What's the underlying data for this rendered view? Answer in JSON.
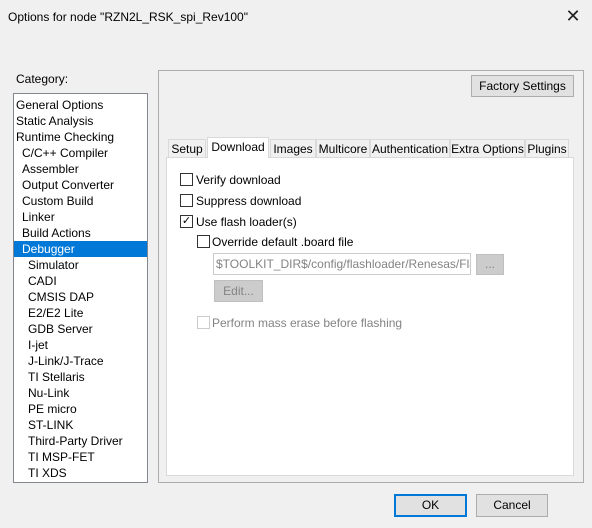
{
  "window": {
    "title": "Options for node \"RZN2L_RSK_spi_Rev100\"",
    "close": "✕"
  },
  "category": {
    "label": "Category:",
    "items": [
      {
        "label": "General Options",
        "level": 0
      },
      {
        "label": "Static Analysis",
        "level": 0
      },
      {
        "label": "Runtime Checking",
        "level": 0
      },
      {
        "label": "C/C++ Compiler",
        "level": 1
      },
      {
        "label": "Assembler",
        "level": 1
      },
      {
        "label": "Output Converter",
        "level": 1
      },
      {
        "label": "Custom Build",
        "level": 1
      },
      {
        "label": "Linker",
        "level": 1
      },
      {
        "label": "Build Actions",
        "level": 1
      },
      {
        "label": "Debugger",
        "level": 1,
        "selected": true
      },
      {
        "label": "Simulator",
        "level": 2
      },
      {
        "label": "CADI",
        "level": 2
      },
      {
        "label": "CMSIS DAP",
        "level": 2
      },
      {
        "label": "E2/E2 Lite",
        "level": 2
      },
      {
        "label": "GDB Server",
        "level": 2
      },
      {
        "label": "I-jet",
        "level": 2
      },
      {
        "label": "J-Link/J-Trace",
        "level": 2
      },
      {
        "label": "TI Stellaris",
        "level": 2
      },
      {
        "label": "Nu-Link",
        "level": 2
      },
      {
        "label": "PE micro",
        "level": 2
      },
      {
        "label": "ST-LINK",
        "level": 2
      },
      {
        "label": "Third-Party Driver",
        "level": 2
      },
      {
        "label": "TI MSP-FET",
        "level": 2
      },
      {
        "label": "TI XDS",
        "level": 2
      }
    ]
  },
  "factory_settings": "Factory Settings",
  "tabs": [
    "Setup",
    "Download",
    "Images",
    "Multicore",
    "Authentication",
    "Extra Options",
    "Plugins"
  ],
  "selected_tab": "Download",
  "download": {
    "verify": {
      "label": "Verify download",
      "checked": false
    },
    "suppress": {
      "label": "Suppress download",
      "checked": false
    },
    "flash_loader": {
      "label": "Use flash loader(s)",
      "checked": true
    },
    "override": {
      "label": "Override default .board file",
      "checked": false
    },
    "board_path": "$TOOLKIT_DIR$/config/flashloader/Renesas/FlashI",
    "browse": "...",
    "edit": "Edit...",
    "mass_erase": {
      "label": "Perform mass erase before flashing",
      "checked": false,
      "disabled": true
    }
  },
  "buttons": {
    "ok": "OK",
    "cancel": "Cancel"
  },
  "colors": {
    "selection": "#0078d7",
    "default_button_border": "#0078d7"
  }
}
